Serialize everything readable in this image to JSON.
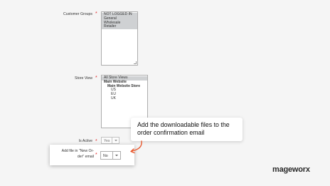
{
  "form": {
    "customer_groups": {
      "label": "Customer Groups",
      "options": [
        "NOT LOGGED IN",
        "General",
        "Wholesale",
        "Retailer"
      ]
    },
    "store_view": {
      "label": "Store View",
      "options": [
        "All Store Views",
        "Main Website",
        "Main Website Store",
        "US",
        "EU",
        "UK"
      ]
    },
    "is_active": {
      "label": "Is Active",
      "value": "Yes"
    },
    "add_file": {
      "label_line1": "Add file in \"New Or-",
      "label_line2": "der\" email",
      "value": "No"
    }
  },
  "callout": {
    "line1": "Add the downloadable files to the",
    "line2": "order confirmation email",
    "arrow_color": "#e8592f"
  },
  "brand": {
    "logo": "mageworx"
  },
  "colors": {
    "required": "#e22626",
    "selected_option": "#cfd1d3"
  }
}
